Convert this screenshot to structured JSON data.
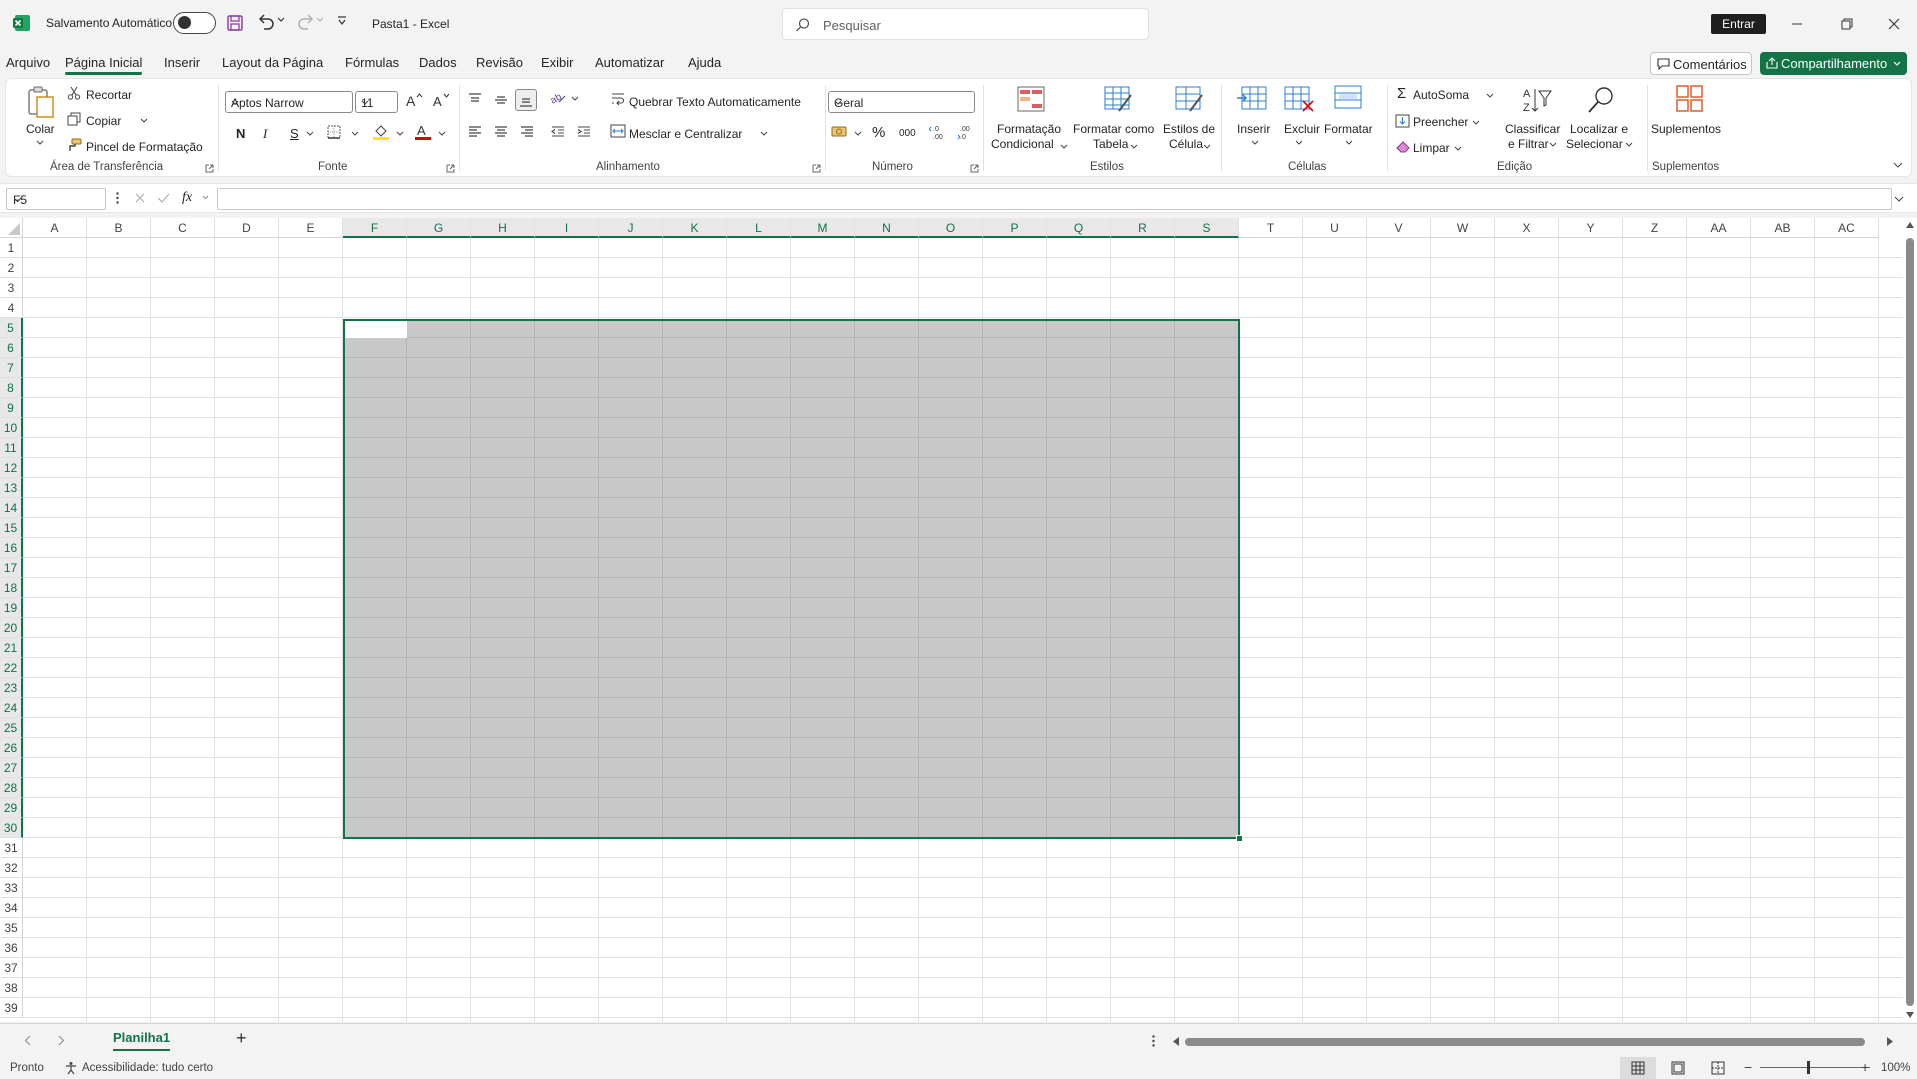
{
  "titlebar": {
    "autosave_label": "Salvamento Automático",
    "doc_title": "Pasta1  -  Excel",
    "search_placeholder": "Pesquisar",
    "signin_label": "Entrar"
  },
  "menu": {
    "tabs": [
      "Arquivo",
      "Página Inicial",
      "Inserir",
      "Layout da Página",
      "Fórmulas",
      "Dados",
      "Revisão",
      "Exibir",
      "Automatizar",
      "Ajuda"
    ],
    "active": "Página Inicial",
    "comments_label": "Comentários",
    "share_label": "Compartilhamento"
  },
  "ribbon": {
    "clipboard": {
      "paste": "Colar",
      "cut": "Recortar",
      "copy": "Copiar",
      "format_painter": "Pincel de Formatação",
      "group": "Área de Transferência"
    },
    "font": {
      "name": "Aptos Narrow",
      "size": "11",
      "bold": "N",
      "italic": "I",
      "underline": "S",
      "group": "Fonte"
    },
    "alignment": {
      "wrap": "Quebrar Texto Automaticamente",
      "merge": "Mesclar e Centralizar",
      "group": "Alinhamento"
    },
    "number": {
      "format": "Geral",
      "percent": "%",
      "thousands": "000",
      "group": "Número"
    },
    "styles": {
      "cond_format_1": "Formatação",
      "cond_format_2": "Condicional",
      "as_table_1": "Formatar como",
      "as_table_2": "Tabela",
      "cell_styles_1": "Estilos de",
      "cell_styles_2": "Célula",
      "group": "Estilos"
    },
    "cells": {
      "insert": "Inserir",
      "delete": "Excluir",
      "format": "Formatar",
      "group": "Células"
    },
    "editing": {
      "autosum": "AutoSoma",
      "fill": "Preencher",
      "clear": "Limpar",
      "sort_1": "Classificar",
      "sort_2": "e Filtrar",
      "find_1": "Localizar e",
      "find_2": "Selecionar",
      "group": "Edição"
    },
    "addins": {
      "label": "Suplementos",
      "group": "Suplementos"
    }
  },
  "formula_bar": {
    "cell_ref": "F5",
    "fx": "fx",
    "content": ""
  },
  "grid": {
    "columns": [
      "A",
      "B",
      "C",
      "D",
      "E",
      "F",
      "G",
      "H",
      "I",
      "J",
      "K",
      "L",
      "M",
      "N",
      "O",
      "P",
      "Q",
      "R",
      "S",
      "T",
      "U",
      "V",
      "W",
      "X",
      "Y",
      "Z",
      "AA",
      "AB",
      "AC"
    ],
    "rows": [
      "1",
      "2",
      "3",
      "4",
      "5",
      "6",
      "7",
      "8",
      "9",
      "10",
      "11",
      "12",
      "13",
      "14",
      "15",
      "16",
      "17",
      "18",
      "19",
      "20",
      "21",
      "22",
      "23",
      "24",
      "25",
      "26",
      "27",
      "28",
      "29",
      "30",
      "31",
      "32",
      "33",
      "34",
      "35",
      "36",
      "37",
      "38",
      "39"
    ],
    "selected_range": "F5:S30"
  },
  "sheets": {
    "tabs": [
      "Planilha1"
    ],
    "add": "+"
  },
  "status": {
    "ready": "Pronto",
    "accessibility": "Acessibilidade: tudo certo",
    "zoom": "100%"
  },
  "colors": {
    "accent": "#117346"
  }
}
